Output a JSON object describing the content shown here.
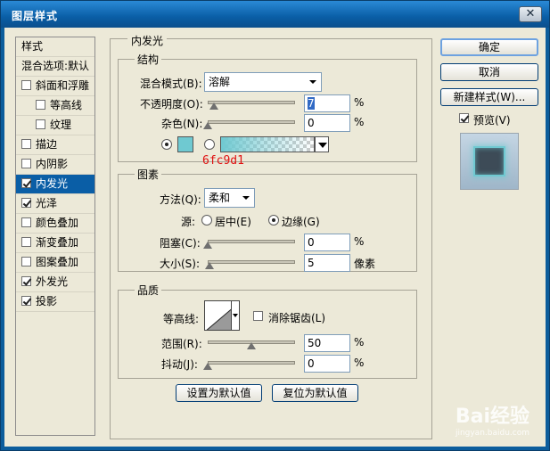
{
  "window": {
    "title": "图层样式",
    "close_glyph": "✕"
  },
  "left_panel": {
    "header": "样式",
    "blend_options": "混合选项:默认",
    "items": [
      {
        "label": "斜面和浮雕",
        "checked": false,
        "sub": false
      },
      {
        "label": "等高线",
        "checked": false,
        "sub": true
      },
      {
        "label": "纹理",
        "checked": false,
        "sub": true
      },
      {
        "label": "描边",
        "checked": false,
        "sub": false
      },
      {
        "label": "内阴影",
        "checked": false,
        "sub": false
      },
      {
        "label": "内发光",
        "checked": true,
        "sub": false,
        "selected": true
      },
      {
        "label": "光泽",
        "checked": true,
        "sub": false
      },
      {
        "label": "颜色叠加",
        "checked": false,
        "sub": false
      },
      {
        "label": "渐变叠加",
        "checked": false,
        "sub": false
      },
      {
        "label": "图案叠加",
        "checked": false,
        "sub": false
      },
      {
        "label": "外发光",
        "checked": true,
        "sub": false
      },
      {
        "label": "投影",
        "checked": true,
        "sub": false
      }
    ]
  },
  "inner_glow": {
    "title": "内发光",
    "structure": {
      "title": "结构",
      "blend_mode_label": "混合模式(B):",
      "blend_mode_value": "溶解",
      "opacity_label": "不透明度(O):",
      "opacity_value": "7",
      "opacity_unit": "%",
      "opacity_level": 0.07,
      "noise_label": "杂色(N):",
      "noise_value": "0",
      "noise_unit": "%",
      "noise_level": 0,
      "color_hex": "#6fc9d1",
      "color_note": "6fc9d1",
      "use_color": true
    },
    "elements": {
      "title": "图素",
      "technique_label": "方法(Q):",
      "technique_value": "柔和",
      "source_label": "源:",
      "source_center": "居中(E)",
      "source_edge": "边缘(G)",
      "source_selected": "edge",
      "choke_label": "阻塞(C):",
      "choke_value": "0",
      "choke_unit": "%",
      "choke_level": 0,
      "size_label": "大小(S):",
      "size_value": "5",
      "size_unit": "像素",
      "size_level": 0.02
    },
    "quality": {
      "title": "品质",
      "contour_label": "等高线:",
      "anti_alias_label": "消除锯齿(L)",
      "anti_alias_checked": false,
      "range_label": "范围(R):",
      "range_value": "50",
      "range_unit": "%",
      "range_level": 0.5,
      "jitter_label": "抖动(J):",
      "jitter_value": "0",
      "jitter_unit": "%",
      "jitter_level": 0
    },
    "make_default": "设置为默认值",
    "reset_default": "复位为默认值"
  },
  "right_panel": {
    "ok": "确定",
    "cancel": "取消",
    "new_style": "新建样式(W)...",
    "preview_label": "预览(V)",
    "preview_checked": true
  },
  "watermark": {
    "main": "Bai经验",
    "sub": "jingyan.baidu.com"
  }
}
